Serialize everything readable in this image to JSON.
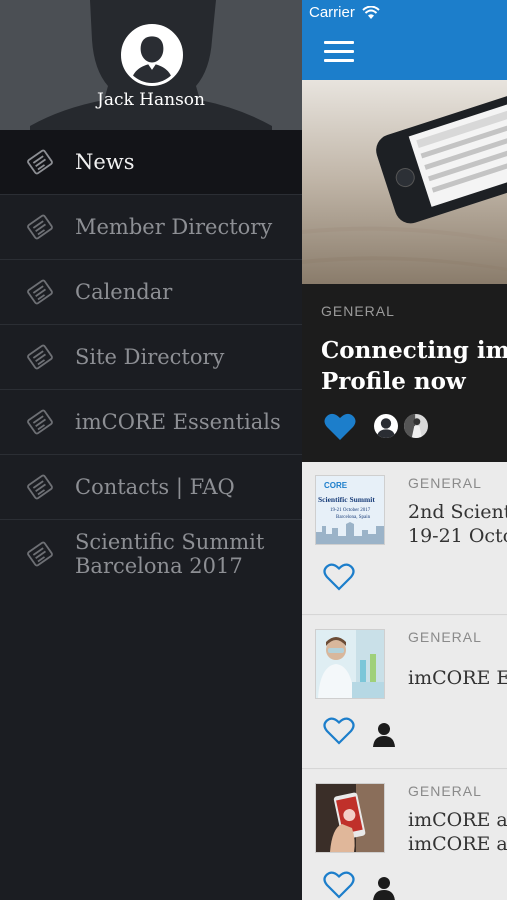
{
  "drawer": {
    "user_name": "Jack Hanson",
    "menu": [
      {
        "label": "News",
        "icon": "newspaper-icon",
        "active": true
      },
      {
        "label": "Member Directory",
        "icon": "newspaper-icon"
      },
      {
        "label": "Calendar",
        "icon": "newspaper-icon"
      },
      {
        "label": "Site Directory",
        "icon": "newspaper-icon"
      },
      {
        "label": "imCORE Essentials",
        "icon": "newspaper-icon"
      },
      {
        "label": "Contacts | FAQ",
        "icon": "newspaper-icon"
      },
      {
        "label": "Scientific Summit\nBarcelona 2017",
        "icon": "newspaper-icon"
      }
    ]
  },
  "status_bar": {
    "carrier": "Carrier"
  },
  "colors": {
    "accent": "#1c7ecb",
    "drawer_bg": "#1b1d22",
    "like_blue": "#1c7ecb"
  },
  "featured": {
    "category": "GENERAL",
    "title": "Connecting im\nProfile now",
    "liked": true
  },
  "posts": [
    {
      "category": "GENERAL",
      "title": "2nd Scient\n19-21 Octo",
      "thumb_text": {
        "brand": "CORE",
        "heading": "Scientific Summit",
        "dates": "19-21 October 2017",
        "place": "Barcelona, Spain"
      }
    },
    {
      "category": "GENERAL",
      "title": "imCORE E"
    },
    {
      "category": "GENERAL",
      "title": "imCORE a\nimCORE a"
    }
  ]
}
